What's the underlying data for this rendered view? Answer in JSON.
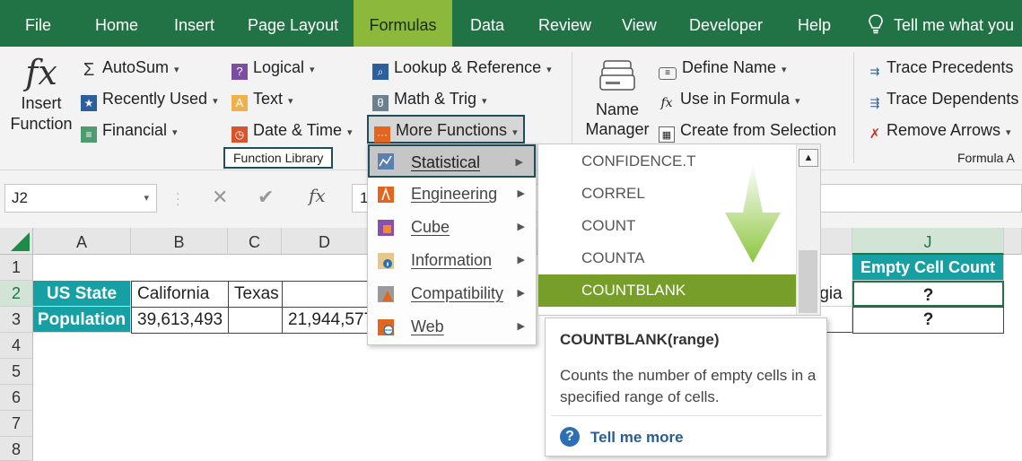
{
  "tabs": [
    "File",
    "Home",
    "Insert",
    "Page Layout",
    "Formulas",
    "Data",
    "Review",
    "View",
    "Developer",
    "Help"
  ],
  "active_tab": "Formulas",
  "tell_me": "Tell me what you",
  "ribbon": {
    "insert_function": {
      "line1": "Insert",
      "line2": "Function",
      "icon_glyph": "fx"
    },
    "col1": [
      "AutoSum",
      "Recently Used",
      "Financial"
    ],
    "col2": [
      "Logical",
      "Text",
      "Date & Time"
    ],
    "col3": [
      "Lookup & Reference",
      "Math & Trig",
      "More Functions"
    ],
    "group_function_library": "Function Library",
    "name_manager": {
      "line1": "Name",
      "line2": "Manager"
    },
    "defined_names": [
      "Define Name",
      "Use in Formula",
      "Create from Selection"
    ],
    "auditing": [
      "Trace Precedents",
      "Trace Dependents",
      "Remove Arrows"
    ],
    "group_formula_auditing": "Formula A"
  },
  "formula_bar": {
    "name_box": "J2",
    "cancel_glyph": "✕",
    "enter_glyph": "✔",
    "fx_glyph": "fx",
    "content": "1"
  },
  "grid": {
    "columns": [
      "A",
      "B",
      "C",
      "D",
      "J"
    ],
    "selected_column": "J",
    "rows": [
      "1",
      "2",
      "3",
      "4",
      "5",
      "6",
      "7",
      "8"
    ],
    "cells": {
      "J1": "Empty Cell Count",
      "A2": "US State",
      "B2": "California",
      "C2": "Texas",
      "I2": "rgia",
      "J2": "?",
      "A3": "Population",
      "B3": "39,613,493",
      "D3": "21,944,577",
      "J3": "?"
    }
  },
  "more_functions_menu": [
    {
      "label": "Statistical",
      "icon": "statistical-icon"
    },
    {
      "label": "Engineering",
      "icon": "engineering-icon"
    },
    {
      "label": "Cube",
      "icon": "cube-icon"
    },
    {
      "label": "Information",
      "icon": "information-icon"
    },
    {
      "label": "Compatibility",
      "icon": "compatibility-icon"
    },
    {
      "label": "Web",
      "icon": "web-icon"
    }
  ],
  "statistical_menu": [
    "CONFIDENCE.T",
    "CORREL",
    "COUNT",
    "COUNTA",
    "COUNTBLANK"
  ],
  "highlighted_function": "COUNTBLANK",
  "tooltip": {
    "title": "COUNTBLANK(range)",
    "description": "Counts the number of empty cells in a specified range of cells.",
    "link": "Tell me more",
    "help_glyph": "?"
  },
  "colors": {
    "excel_green": "#217346",
    "active_tab": "#8cb83c",
    "header_teal": "#16a0a4",
    "highlight_olive": "#789e2a",
    "arrow_green": "#8cc63f"
  }
}
